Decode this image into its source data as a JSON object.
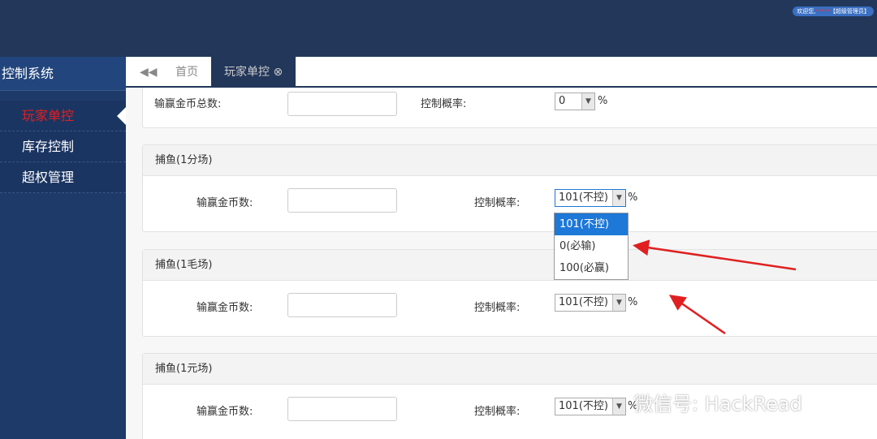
{
  "header": {
    "welcome": "欢迎您,",
    "user": "*****",
    "role": "【超级管理员】"
  },
  "sidebar": {
    "title": "控制系统",
    "items": [
      {
        "label": "玩家单控"
      },
      {
        "label": "库存控制"
      },
      {
        "label": "超权管理"
      }
    ]
  },
  "tabs": [
    {
      "label": "首页"
    },
    {
      "label": "玩家单控 ⊗"
    }
  ],
  "top_panel": {
    "total_label": "输赢金币总数:",
    "rate_label": "控制概率:",
    "rate_value": "0",
    "pct": "%"
  },
  "panels": [
    {
      "title": "捕鱼(1分场)",
      "coin_label": "输赢金币数:",
      "rate_label": "控制概率:",
      "rate_value": "101(不控)",
      "pct": "%"
    },
    {
      "title": "捕鱼(1毛场)",
      "coin_label": "输赢金币数:",
      "rate_label": "控制概率:",
      "rate_value": "101(不控)",
      "pct": "%"
    },
    {
      "title": "捕鱼(1元场)",
      "coin_label": "输赢金币数:",
      "rate_label": "控制概率:",
      "rate_value": "101(不控)",
      "pct": "%"
    }
  ],
  "dropdown_options": [
    "101(不控)",
    "0(必输)",
    "100(必赢)"
  ],
  "watermark": "微信号: HackRead",
  "colors": {
    "header": "#22375a",
    "sidebar": "#1e3a68",
    "active_menu": "#e02020",
    "selected_option": "#1e78d7",
    "annotation": "#e02020"
  }
}
